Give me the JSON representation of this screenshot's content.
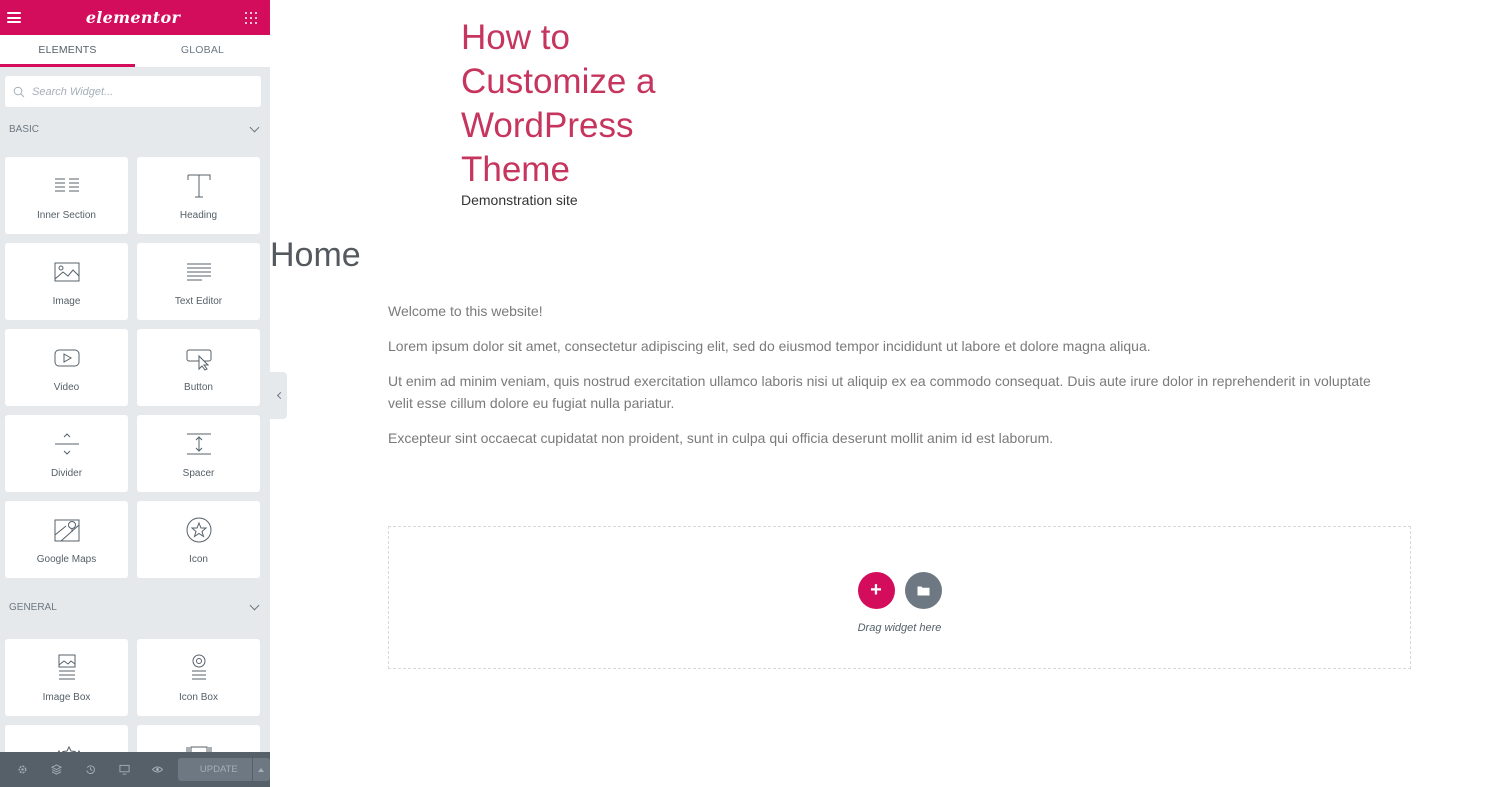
{
  "sidebar": {
    "brand": "elementor",
    "tabs": [
      {
        "label": "ELEMENTS",
        "active": true
      },
      {
        "label": "GLOBAL",
        "active": false
      }
    ],
    "search": {
      "placeholder": "Search Widget..."
    },
    "categories": {
      "basic": {
        "label": "BASIC",
        "widgets": [
          {
            "label": "Inner Section",
            "icon": "inner-section-icon"
          },
          {
            "label": "Heading",
            "icon": "heading-icon"
          },
          {
            "label": "Image",
            "icon": "image-icon"
          },
          {
            "label": "Text Editor",
            "icon": "text-editor-icon"
          },
          {
            "label": "Video",
            "icon": "video-icon"
          },
          {
            "label": "Button",
            "icon": "button-icon"
          },
          {
            "label": "Divider",
            "icon": "divider-icon"
          },
          {
            "label": "Spacer",
            "icon": "spacer-icon"
          },
          {
            "label": "Google Maps",
            "icon": "map-icon"
          },
          {
            "label": "Icon",
            "icon": "star-icon"
          }
        ]
      },
      "general": {
        "label": "GENERAL",
        "widgets": [
          {
            "label": "Image Box",
            "icon": "image-box-icon"
          },
          {
            "label": "Icon Box",
            "icon": "icon-box-icon"
          },
          {
            "label": "",
            "icon": "star-rating-icon"
          },
          {
            "label": "",
            "icon": "carousel-icon"
          }
        ]
      }
    },
    "footer": {
      "update_label": "UPDATE",
      "icons": [
        "settings-icon",
        "navigator-icon",
        "history-icon",
        "responsive-icon",
        "preview-icon"
      ]
    }
  },
  "preview": {
    "site_title": "How to Customize a WordPress Theme",
    "site_description": "Demonstration site",
    "page_title": "Home",
    "paragraphs": [
      "Welcome to this website!",
      "Lorem ipsum dolor sit amet, consectetur adipiscing elit, sed do eiusmod tempor incididunt ut labore et dolore magna aliqua.",
      "Ut enim ad minim veniam, quis nostrud exercitation ullamco laboris nisi ut aliquip ex ea commodo consequat. Duis aute irure dolor in reprehenderit in voluptate velit esse cillum dolore eu fugiat nulla pariatur.",
      "Excepteur sint occaecat cupidatat non proident, sunt in culpa qui officia deserunt mollit anim id est laborum."
    ],
    "dropzone": {
      "label": "Drag widget here",
      "add_symbol": "+"
    }
  },
  "colors": {
    "brand": "#d30c5c",
    "title": "#c6355e",
    "panel_bg": "#e6e9ec",
    "footer_bg": "#556068"
  }
}
